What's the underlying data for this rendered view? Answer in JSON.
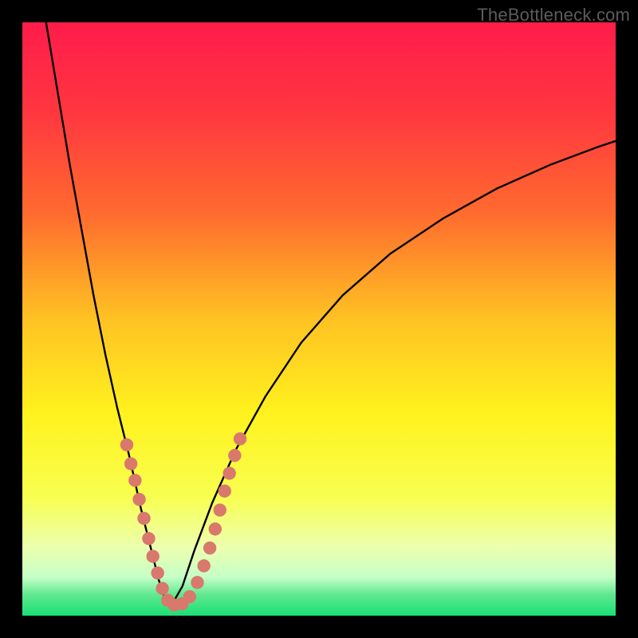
{
  "watermark": "TheBottleneck.com",
  "colors": {
    "frame": "#000000",
    "curve_stroke": "#000000",
    "marker_fill": "#d9786d",
    "marker_stroke": "#b25047"
  },
  "chart_data": {
    "type": "line",
    "title": "",
    "xlabel": "",
    "ylabel": "",
    "xlim": [
      0,
      100
    ],
    "ylim": [
      0,
      100
    ],
    "x_optimum": 25,
    "gradient_stops": [
      {
        "offset": 0.0,
        "color": "#ff1c4b"
      },
      {
        "offset": 0.15,
        "color": "#ff3640"
      },
      {
        "offset": 0.32,
        "color": "#ff6a2f"
      },
      {
        "offset": 0.5,
        "color": "#ffc223"
      },
      {
        "offset": 0.66,
        "color": "#fff21e"
      },
      {
        "offset": 0.8,
        "color": "#f8ff50"
      },
      {
        "offset": 0.885,
        "color": "#ecffaf"
      },
      {
        "offset": 0.935,
        "color": "#c6ffc6"
      },
      {
        "offset": 0.965,
        "color": "#5fe88f"
      },
      {
        "offset": 1.0,
        "color": "#1bdf74"
      }
    ],
    "series": [
      {
        "name": "bottleneck-curve-left",
        "x": [
          4,
          6,
          8,
          10,
          12,
          14,
          16,
          18,
          20,
          21,
          22,
          23,
          24,
          25
        ],
        "values": [
          100,
          88,
          76,
          65,
          54,
          44,
          35,
          27,
          18,
          14,
          10,
          6,
          3,
          1.5
        ]
      },
      {
        "name": "bottleneck-curve-right",
        "x": [
          25,
          27,
          29,
          32,
          36,
          41,
          47,
          54,
          62,
          71,
          80,
          89,
          97,
          100
        ],
        "values": [
          1.5,
          5,
          11,
          19,
          28,
          37,
          46,
          54,
          61,
          67,
          72,
          76,
          79,
          80
        ]
      }
    ],
    "markers": [
      {
        "x": 17.6,
        "y": 28.8
      },
      {
        "x": 18.3,
        "y": 25.6
      },
      {
        "x": 19.0,
        "y": 22.8
      },
      {
        "x": 19.7,
        "y": 19.6
      },
      {
        "x": 20.5,
        "y": 16.4
      },
      {
        "x": 21.3,
        "y": 13.0
      },
      {
        "x": 22.0,
        "y": 10.0
      },
      {
        "x": 22.8,
        "y": 7.2
      },
      {
        "x": 23.6,
        "y": 4.6
      },
      {
        "x": 24.5,
        "y": 2.6
      },
      {
        "x": 25.6,
        "y": 1.8
      },
      {
        "x": 26.9,
        "y": 2.0
      },
      {
        "x": 28.2,
        "y": 3.2
      },
      {
        "x": 29.5,
        "y": 5.6
      },
      {
        "x": 30.6,
        "y": 8.4
      },
      {
        "x": 31.6,
        "y": 11.4
      },
      {
        "x": 32.5,
        "y": 14.6
      },
      {
        "x": 33.3,
        "y": 17.8
      },
      {
        "x": 34.1,
        "y": 21.0
      },
      {
        "x": 34.9,
        "y": 24.0
      },
      {
        "x": 35.8,
        "y": 27.0
      },
      {
        "x": 36.7,
        "y": 29.8
      }
    ]
  }
}
